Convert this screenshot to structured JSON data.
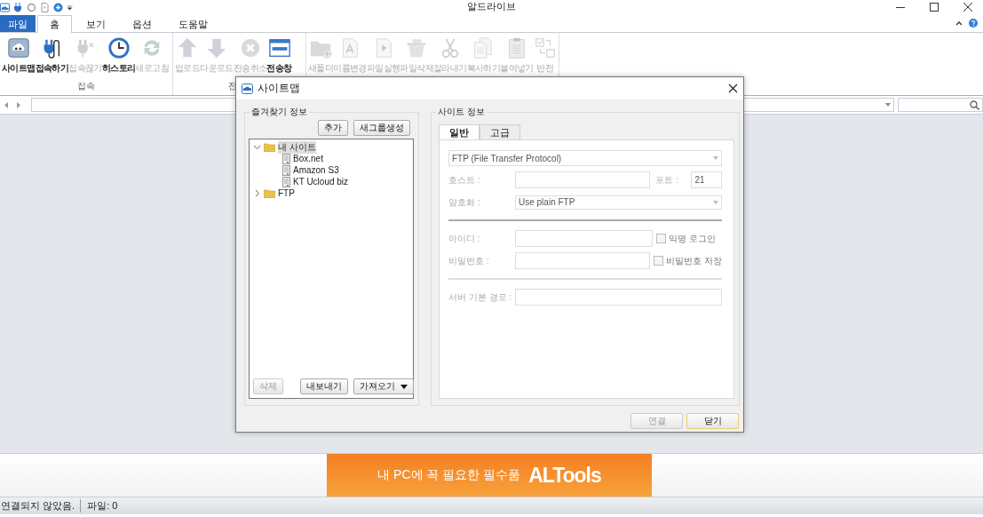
{
  "window": {
    "title": "알드라이브"
  },
  "ribbon_tabs": [
    {
      "label": "파일",
      "kind": "file",
      "selected": false
    },
    {
      "label": "홈",
      "kind": "tab",
      "selected": true
    },
    {
      "label": "보기",
      "kind": "tab",
      "selected": false
    },
    {
      "label": "옵션",
      "kind": "tab",
      "selected": false
    },
    {
      "label": "도움말",
      "kind": "tab",
      "selected": false
    }
  ],
  "ribbon_groups": [
    {
      "label": "접속",
      "buttons": [
        {
          "label": "사이트맵",
          "disabled": false
        },
        {
          "label": "접속하기",
          "disabled": false
        },
        {
          "label": "접속끊기",
          "disabled": true
        },
        {
          "label": "히스토리",
          "disabled": false
        },
        {
          "label": "새로고침",
          "disabled": true
        }
      ]
    },
    {
      "label": "전",
      "buttons": [
        {
          "label": "업로드",
          "disabled": true
        },
        {
          "label": "다운로드",
          "disabled": true
        },
        {
          "label": "전송취소",
          "disabled": true
        },
        {
          "label": "전송창",
          "disabled": false
        }
      ]
    },
    {
      "buttons": [
        {
          "label": "새폴더",
          "disabled": true
        },
        {
          "label": "이름변경",
          "disabled": true
        },
        {
          "label": "파일실행",
          "disabled": true
        },
        {
          "label": "파일삭제",
          "disabled": true
        },
        {
          "label": "잘라내기",
          "disabled": true
        },
        {
          "label": "복사하기",
          "disabled": true
        },
        {
          "label": "붙여넣기",
          "disabled": true
        },
        {
          "label": "반전",
          "disabled": true
        }
      ]
    }
  ],
  "dialog": {
    "title": "사이트맵",
    "favorites": {
      "legend": "즐겨찾기 정보",
      "top_buttons": [
        {
          "label": "추가",
          "disabled": false
        },
        {
          "label": "새그룹생성",
          "disabled": false
        }
      ],
      "tree": [
        {
          "label": "내 사이트",
          "kind": "folder",
          "expanded": true,
          "selected": true,
          "children": [
            {
              "label": "Box.net",
              "kind": "server",
              "selected": false
            },
            {
              "label": "Amazon S3",
              "kind": "server",
              "selected": false
            },
            {
              "label": "KT Ucloud biz",
              "kind": "server",
              "selected": false
            }
          ]
        },
        {
          "label": "FTP",
          "kind": "folder",
          "expanded": false,
          "selected": false
        }
      ],
      "bottom_buttons": [
        {
          "label": "삭제",
          "disabled": true,
          "dropdown": false
        },
        {
          "label": "내보내기",
          "disabled": false,
          "dropdown": false
        },
        {
          "label": "가져오기",
          "disabled": false,
          "dropdown": true
        }
      ]
    },
    "site_info": {
      "legend": "사이트 정보",
      "tabs": [
        {
          "label": "일반",
          "selected": true
        },
        {
          "label": "고급",
          "selected": false
        }
      ],
      "protocol": {
        "value": "FTP (File Transfer Protocol)"
      },
      "host": {
        "label": "호스트 :"
      },
      "port": {
        "label": "포트 :",
        "value": "21"
      },
      "encryption": {
        "label": "암호화 :",
        "value": "Use plain FTP"
      },
      "user": {
        "label": "아이디 :",
        "checkbox": {
          "label": "익명 로그인",
          "checked": false
        }
      },
      "password": {
        "label": "비밀번호 :",
        "checkbox": {
          "label": "비밀번호 저장",
          "checked": false
        }
      },
      "base_path": {
        "label": "서버 기본 경로 :"
      }
    },
    "buttons": [
      {
        "label": "연결",
        "disabled": true,
        "default": false
      },
      {
        "label": "닫기",
        "disabled": false,
        "default": true
      }
    ]
  },
  "banner": {
    "text": "내 PC에 꼭 필요한 필수품",
    "brand": "ALTools"
  },
  "status_bar": [
    "연결되지 않았음.",
    "파일: 0"
  ]
}
